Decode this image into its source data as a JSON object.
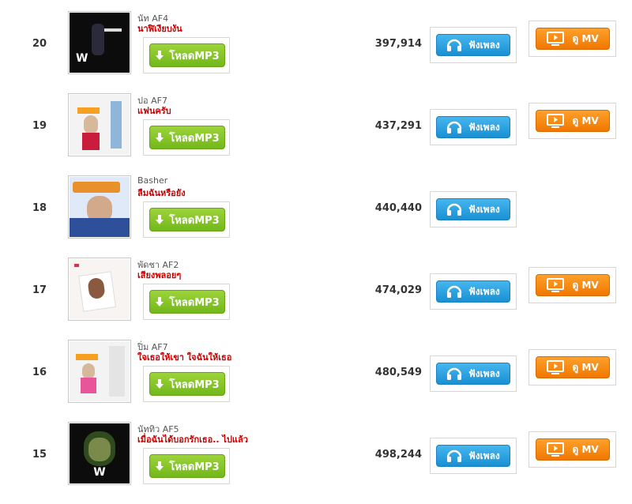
{
  "buttons": {
    "download": "โหลดMP3",
    "listen": "ฟังเพลง",
    "mv_prefix": "ดู",
    "mv_suffix": "MV"
  },
  "rows": [
    {
      "rank": "20",
      "artist": "นัท AF4",
      "song": "นาฬิเงียบงัน",
      "plays": "397,914",
      "cover": "dark",
      "mv": true
    },
    {
      "rank": "19",
      "artist": "ปอ AF7",
      "song": "แฟนครับ",
      "plays": "437,291",
      "cover": "light",
      "mv": true
    },
    {
      "rank": "18",
      "artist": "Basher",
      "song": "ลืมฉันหรือยัง",
      "plays": "440,440",
      "cover": "blue",
      "mv": false
    },
    {
      "rank": "17",
      "artist": "พัดชา AF2",
      "song": "เสียงพลอยๆ",
      "plays": "474,029",
      "cover": "light",
      "mv": true
    },
    {
      "rank": "16",
      "artist": "ปิ่ม AF7",
      "song": "ใจเธอให้เขา ใจฉันให้เธอ",
      "plays": "480,549",
      "cover": "light",
      "mv": true
    },
    {
      "rank": "15",
      "artist": "นัททิว AF5",
      "song": "เมื่อฉันได้บอกรักเธอ.. ไปแล้ว",
      "plays": "498,244",
      "cover": "dark",
      "mv": true
    }
  ],
  "colors": {
    "download_green": "#7ec223",
    "listen_blue": "#2ba3e2",
    "mv_orange": "#f7860f",
    "song_red": "#cc0000"
  }
}
